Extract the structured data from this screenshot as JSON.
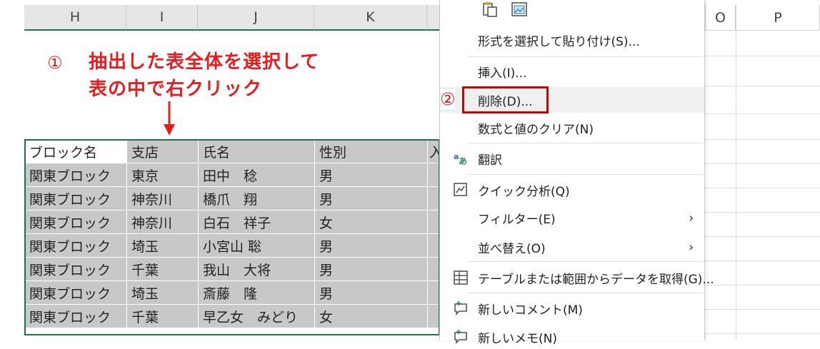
{
  "columns": {
    "H": "H",
    "I": "I",
    "J": "J",
    "K": "K",
    "O": "O",
    "P": "P"
  },
  "annotations": {
    "step1_number": "①",
    "step1_line1": "抽出した表全体を選択して",
    "step1_line2": "表の中で右クリック",
    "arrow": "↓",
    "step2_number": "②"
  },
  "table": {
    "headers": [
      "ブロック名",
      "支店",
      "氏名",
      "性別",
      "入"
    ],
    "rows": [
      [
        "関東ブロック",
        "東京",
        "田中　稔",
        "男"
      ],
      [
        "関東ブロック",
        "神奈川",
        "橋爪　翔",
        "男"
      ],
      [
        "関東ブロック",
        "神奈川",
        "白石　祥子",
        "女"
      ],
      [
        "関東ブロック",
        "埼玉",
        "小宮山 聡",
        "男"
      ],
      [
        "関東ブロック",
        "千葉",
        "我山　大将",
        "男"
      ],
      [
        "関東ブロック",
        "埼玉",
        "斎藤　隆",
        "男"
      ],
      [
        "関東ブロック",
        "千葉",
        "早乙女　みどり",
        "女"
      ]
    ]
  },
  "menu": {
    "paste_special": "形式を選択して貼り付け(S)...",
    "insert": "挿入(I)...",
    "delete": "削除(D)...",
    "clear_contents": "数式と値のクリア(N)",
    "translate": "翻訳",
    "quick_analysis": "クイック分析(Q)",
    "filter": "フィルター(E)",
    "sort": "並べ替え(O)",
    "get_data": "テーブルまたは範囲からデータを取得(G)...",
    "new_comment": "新しいコメント(M)",
    "new_note": "新しいメモ(N)",
    "chevron": "›"
  },
  "colors": {
    "accent_green": "#217346",
    "annotation_red": "#e02020",
    "selection_gray": "#c8c8c8"
  }
}
